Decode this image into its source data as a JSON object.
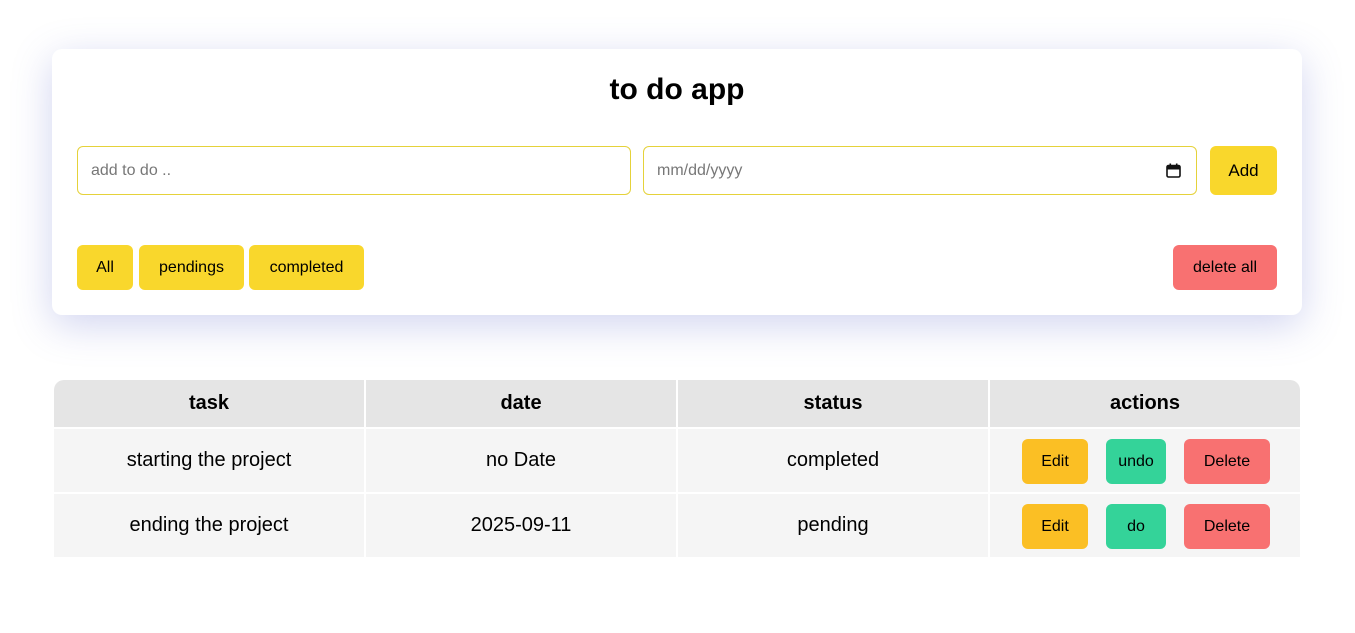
{
  "app": {
    "title": "to do app"
  },
  "form": {
    "task_placeholder": "add to do ..",
    "date_placeholder": "mm/dd/yyyy",
    "add_label": "Add"
  },
  "filters": {
    "all_label": "All",
    "pending_label": "pendings",
    "completed_label": "completed",
    "delete_all_label": "delete all"
  },
  "table": {
    "headers": [
      "task",
      "date",
      "status",
      "actions"
    ],
    "rows": [
      {
        "task": "starting the project",
        "date": "no Date",
        "status": "completed",
        "edit": "Edit",
        "toggle": "undo",
        "delete": "Delete"
      },
      {
        "task": "ending the project",
        "date": "2025-09-11",
        "status": "pending",
        "edit": "Edit",
        "toggle": "do",
        "delete": "Delete"
      }
    ]
  },
  "colors": {
    "accent_yellow": "#f9d72c",
    "danger_red": "#f87171",
    "edit_amber": "#fbbf24",
    "toggle_green": "#34d399"
  },
  "icons": {
    "date_picker": "calendar-icon"
  }
}
